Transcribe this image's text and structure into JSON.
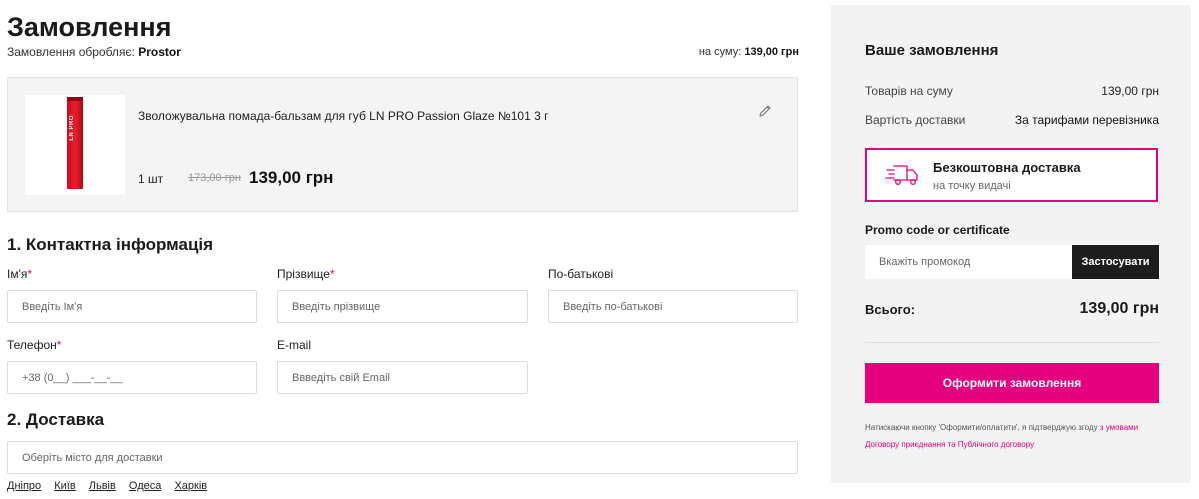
{
  "header": {
    "title": "Замовлення",
    "processor_prefix": "Замовлення обробляє:",
    "processor_name": "Prostor",
    "sum_prefix": "на суму:",
    "sum_value": "139,00 грн"
  },
  "product": {
    "brand_mark": "LN PRO",
    "name": "Зволожувальна помада-бальзам для губ LN PRO Passion Glaze №101 3 г",
    "qty": "1 шт",
    "old_price": "173,00 грн",
    "price": "139,00 грн",
    "edit_icon": "pencil-icon"
  },
  "contact": {
    "title": "1. Контактна інформація",
    "first_name": {
      "label": "Ім'я",
      "required": "*",
      "placeholder": "Введіть Ім'я"
    },
    "last_name": {
      "label": "Прізвище",
      "required": "*",
      "placeholder": "Введіть прізвище"
    },
    "middle_name": {
      "label": "По-батькові",
      "placeholder": "Введіть по-батькові"
    },
    "phone": {
      "label": "Телефон",
      "required": "*",
      "placeholder": "+38 (0__) ___-__-__"
    },
    "email": {
      "label": "E-mail",
      "placeholder": "Ввведіть свій Email"
    }
  },
  "delivery": {
    "title": "2. Доставка",
    "city_placeholder": "Оберіть місто для доставки",
    "cities": [
      "Дніпро",
      "Київ",
      "Львів",
      "Одеса",
      "Харків"
    ]
  },
  "summary": {
    "title": "Ваше замовлення",
    "goods_label": "Товарів на суму",
    "goods_value": "139,00 грн",
    "shipping_label": "Вартість доставки",
    "shipping_value": "За тарифами перевізника",
    "free_delivery_icon": "fast-truck-icon",
    "free_delivery_title": "Безкоштовна доставка",
    "free_delivery_sub": "на точку видачі",
    "promo_label": "Promo code or certificate",
    "promo_placeholder": "Вкажіть промокод",
    "promo_button": "Застосувати",
    "total_label": "Всього:",
    "total_value": "139,00 грн",
    "order_button": "Оформити замовлення",
    "terms_text": "Натискаючи кнопку 'Оформити/оплатити', я підтверджую згоду ",
    "terms_link_1": "з умовами",
    "terms_link_2": "Договору приєднання та Публічного договору"
  },
  "colors": {
    "accent": "#e5007e",
    "dark_button": "#1d1d1d",
    "panel_bg": "#f3f3f3"
  }
}
